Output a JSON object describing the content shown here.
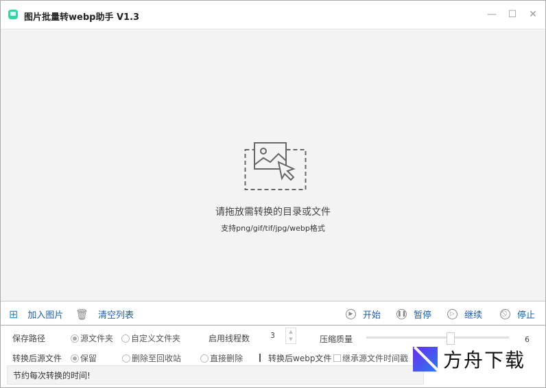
{
  "app": {
    "title": "图片批量转webp助手 V1.3"
  },
  "window_controls": {
    "minimize": "—",
    "maximize": "☐",
    "close": "✕"
  },
  "dropzone": {
    "main_text": "请拖放需转换的目录或文件",
    "sub_text": "支持png/gif/tif/jpg/webp格式"
  },
  "toolbar": {
    "add_images": "加入图片",
    "clear_list": "清空列表",
    "start": "开始",
    "pause": "暂停",
    "resume": "继续",
    "stop": "停止"
  },
  "options": {
    "save_path_label": "保存路径",
    "save_path_options": [
      "源文件夹",
      "自定义文件夹"
    ],
    "save_path_selected": 0,
    "threads_label": "启用线程数",
    "threads_value": "3",
    "quality_label": "压缩质量",
    "quality_value": "6",
    "quality_fraction": 0.6,
    "after_label": "转换后源文件",
    "after_options": [
      "保留",
      "删除至回收站",
      "直接删除"
    ],
    "after_selected": 0,
    "webp_label": "转换后webp文件",
    "inherit_timestamp": "继承源文件时间戳",
    "inherit_checked": false
  },
  "status": {
    "text": "节约每次转换的时间!"
  },
  "watermark": {
    "text": "方舟下载"
  }
}
